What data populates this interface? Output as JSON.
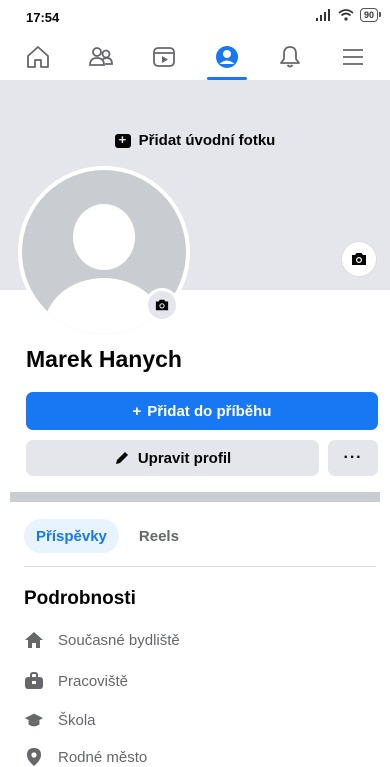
{
  "status_bar": {
    "time": "17:54",
    "battery": "90"
  },
  "nav": {
    "tabs": [
      {
        "icon": "home-icon"
      },
      {
        "icon": "friends-icon"
      },
      {
        "icon": "video-icon"
      },
      {
        "icon": "profile-icon",
        "active": true
      },
      {
        "icon": "bell-icon"
      },
      {
        "icon": "menu-icon"
      }
    ]
  },
  "cover": {
    "add_cover_label": "Přidat úvodní fotku"
  },
  "profile": {
    "name": "Marek Hanych",
    "add_story_label": "Přidat do příběhu",
    "add_story_icon": "+",
    "edit_profile_label": "Upravit profil",
    "more_label": "···"
  },
  "tabs": [
    {
      "label": "Příspěvky",
      "active": true
    },
    {
      "label": "Reels",
      "active": false
    }
  ],
  "details": {
    "title": "Podrobnosti",
    "items": [
      {
        "icon": "home-filled-icon",
        "label": "Současné bydliště"
      },
      {
        "icon": "briefcase-icon",
        "label": "Pracoviště"
      },
      {
        "icon": "graduation-cap-icon",
        "label": "Škola"
      },
      {
        "icon": "location-pin-icon",
        "label": "Rodné město"
      }
    ]
  },
  "colors": {
    "accent": "#1877f2",
    "cover_bg": "#e4e6eb",
    "muted_text": "#65676b"
  }
}
